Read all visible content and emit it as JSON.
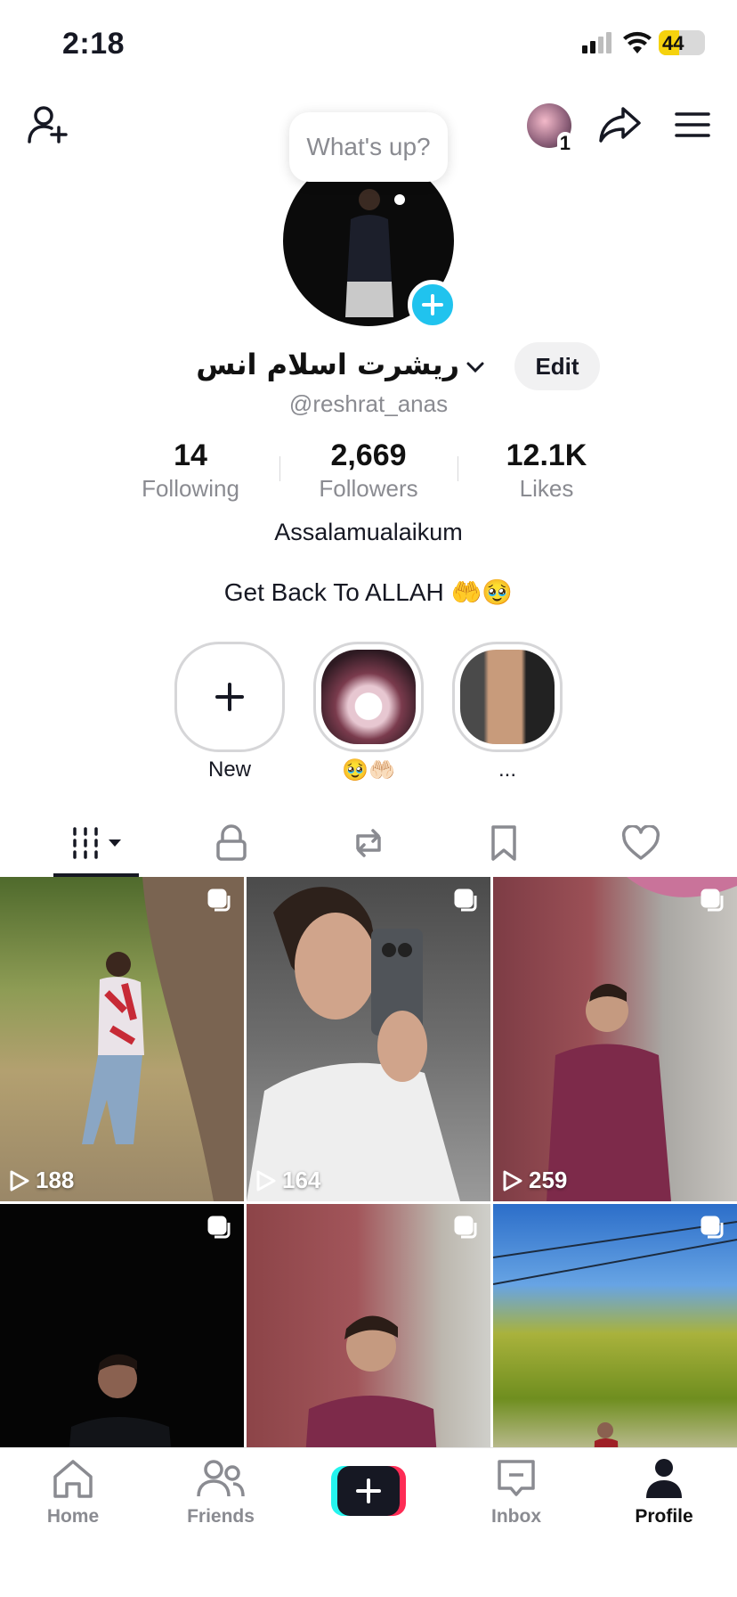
{
  "status_bar": {
    "time": "2:18",
    "battery": "44",
    "battery_level": 0.44,
    "battery_color": "#f5d20d",
    "icons": [
      "cellular-signal-icon",
      "wifi-icon",
      "battery-charging-icon"
    ]
  },
  "header": {
    "icons": [
      "add-friend-icon",
      "avatar",
      "share-icon",
      "menu-icon"
    ],
    "notification_count": "1"
  },
  "profile": {
    "bubble_text": "What's up?",
    "display_name": "ريشرت اسلام انس",
    "edit_label": "Edit",
    "handle": "@reshrat_anas",
    "stats": [
      {
        "value": "14",
        "label": "Following"
      },
      {
        "value": "2,669",
        "label": "Followers"
      },
      {
        "value": "12.1K",
        "label": "Likes"
      }
    ],
    "bio_line1": "Assalamualaikum",
    "bio_line2": "Get Back To ALLAH 🤲🥹"
  },
  "highlights": [
    {
      "label": "New"
    },
    {
      "label": "🥹🤲🏻"
    },
    {
      "label": "..."
    }
  ],
  "tabs": {
    "icons": [
      "videos-grid-icon",
      "lock-icon",
      "repost-icon",
      "bookmark-icon",
      "heart-icon"
    ],
    "active": "videos-grid-icon"
  },
  "videos": [
    {
      "views": "188"
    },
    {
      "views": "164"
    },
    {
      "views": "259"
    },
    {
      "views": ""
    },
    {
      "views": ""
    },
    {
      "views": ""
    }
  ],
  "bottom_nav": {
    "items": [
      {
        "label": "Home",
        "icon": "home-icon"
      },
      {
        "label": "Friends",
        "icon": "friends-icon"
      },
      {
        "label": "",
        "icon": "create-plus-icon"
      },
      {
        "label": "Inbox",
        "icon": "inbox-icon"
      },
      {
        "label": "Profile",
        "icon": "profile-icon"
      }
    ],
    "active": "Profile"
  },
  "colors": {
    "accent_cyan": "#25f4ee",
    "accent_red": "#fe2c55",
    "add_avatar": "#20c3ee",
    "text_primary": "#161823",
    "text_secondary": "#8a8b91"
  }
}
